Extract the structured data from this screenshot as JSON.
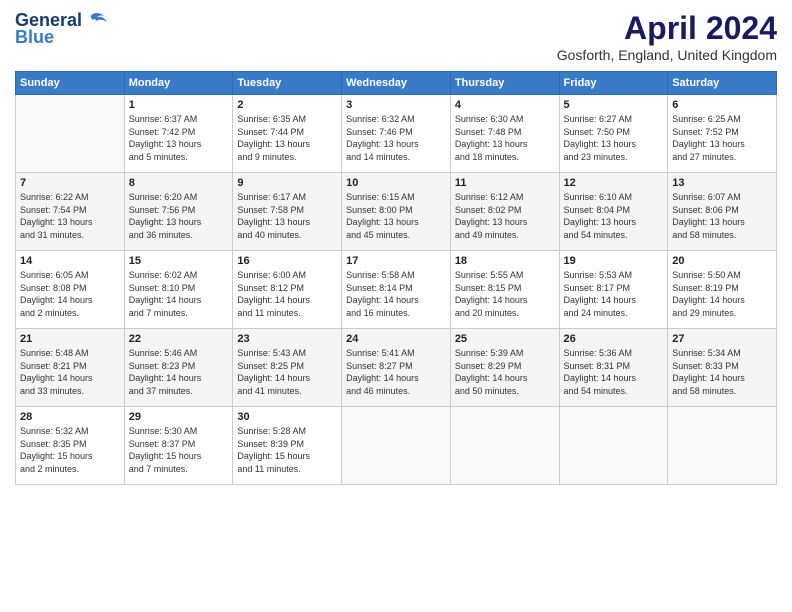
{
  "header": {
    "logo_line1": "General",
    "logo_line2": "Blue",
    "month": "April 2024",
    "location": "Gosforth, England, United Kingdom"
  },
  "weekdays": [
    "Sunday",
    "Monday",
    "Tuesday",
    "Wednesday",
    "Thursday",
    "Friday",
    "Saturday"
  ],
  "weeks": [
    [
      {
        "day": "",
        "info": ""
      },
      {
        "day": "1",
        "info": "Sunrise: 6:37 AM\nSunset: 7:42 PM\nDaylight: 13 hours\nand 5 minutes."
      },
      {
        "day": "2",
        "info": "Sunrise: 6:35 AM\nSunset: 7:44 PM\nDaylight: 13 hours\nand 9 minutes."
      },
      {
        "day": "3",
        "info": "Sunrise: 6:32 AM\nSunset: 7:46 PM\nDaylight: 13 hours\nand 14 minutes."
      },
      {
        "day": "4",
        "info": "Sunrise: 6:30 AM\nSunset: 7:48 PM\nDaylight: 13 hours\nand 18 minutes."
      },
      {
        "day": "5",
        "info": "Sunrise: 6:27 AM\nSunset: 7:50 PM\nDaylight: 13 hours\nand 23 minutes."
      },
      {
        "day": "6",
        "info": "Sunrise: 6:25 AM\nSunset: 7:52 PM\nDaylight: 13 hours\nand 27 minutes."
      }
    ],
    [
      {
        "day": "7",
        "info": "Sunrise: 6:22 AM\nSunset: 7:54 PM\nDaylight: 13 hours\nand 31 minutes."
      },
      {
        "day": "8",
        "info": "Sunrise: 6:20 AM\nSunset: 7:56 PM\nDaylight: 13 hours\nand 36 minutes."
      },
      {
        "day": "9",
        "info": "Sunrise: 6:17 AM\nSunset: 7:58 PM\nDaylight: 13 hours\nand 40 minutes."
      },
      {
        "day": "10",
        "info": "Sunrise: 6:15 AM\nSunset: 8:00 PM\nDaylight: 13 hours\nand 45 minutes."
      },
      {
        "day": "11",
        "info": "Sunrise: 6:12 AM\nSunset: 8:02 PM\nDaylight: 13 hours\nand 49 minutes."
      },
      {
        "day": "12",
        "info": "Sunrise: 6:10 AM\nSunset: 8:04 PM\nDaylight: 13 hours\nand 54 minutes."
      },
      {
        "day": "13",
        "info": "Sunrise: 6:07 AM\nSunset: 8:06 PM\nDaylight: 13 hours\nand 58 minutes."
      }
    ],
    [
      {
        "day": "14",
        "info": "Sunrise: 6:05 AM\nSunset: 8:08 PM\nDaylight: 14 hours\nand 2 minutes."
      },
      {
        "day": "15",
        "info": "Sunrise: 6:02 AM\nSunset: 8:10 PM\nDaylight: 14 hours\nand 7 minutes."
      },
      {
        "day": "16",
        "info": "Sunrise: 6:00 AM\nSunset: 8:12 PM\nDaylight: 14 hours\nand 11 minutes."
      },
      {
        "day": "17",
        "info": "Sunrise: 5:58 AM\nSunset: 8:14 PM\nDaylight: 14 hours\nand 16 minutes."
      },
      {
        "day": "18",
        "info": "Sunrise: 5:55 AM\nSunset: 8:15 PM\nDaylight: 14 hours\nand 20 minutes."
      },
      {
        "day": "19",
        "info": "Sunrise: 5:53 AM\nSunset: 8:17 PM\nDaylight: 14 hours\nand 24 minutes."
      },
      {
        "day": "20",
        "info": "Sunrise: 5:50 AM\nSunset: 8:19 PM\nDaylight: 14 hours\nand 29 minutes."
      }
    ],
    [
      {
        "day": "21",
        "info": "Sunrise: 5:48 AM\nSunset: 8:21 PM\nDaylight: 14 hours\nand 33 minutes."
      },
      {
        "day": "22",
        "info": "Sunrise: 5:46 AM\nSunset: 8:23 PM\nDaylight: 14 hours\nand 37 minutes."
      },
      {
        "day": "23",
        "info": "Sunrise: 5:43 AM\nSunset: 8:25 PM\nDaylight: 14 hours\nand 41 minutes."
      },
      {
        "day": "24",
        "info": "Sunrise: 5:41 AM\nSunset: 8:27 PM\nDaylight: 14 hours\nand 46 minutes."
      },
      {
        "day": "25",
        "info": "Sunrise: 5:39 AM\nSunset: 8:29 PM\nDaylight: 14 hours\nand 50 minutes."
      },
      {
        "day": "26",
        "info": "Sunrise: 5:36 AM\nSunset: 8:31 PM\nDaylight: 14 hours\nand 54 minutes."
      },
      {
        "day": "27",
        "info": "Sunrise: 5:34 AM\nSunset: 8:33 PM\nDaylight: 14 hours\nand 58 minutes."
      }
    ],
    [
      {
        "day": "28",
        "info": "Sunrise: 5:32 AM\nSunset: 8:35 PM\nDaylight: 15 hours\nand 2 minutes."
      },
      {
        "day": "29",
        "info": "Sunrise: 5:30 AM\nSunset: 8:37 PM\nDaylight: 15 hours\nand 7 minutes."
      },
      {
        "day": "30",
        "info": "Sunrise: 5:28 AM\nSunset: 8:39 PM\nDaylight: 15 hours\nand 11 minutes."
      },
      {
        "day": "",
        "info": ""
      },
      {
        "day": "",
        "info": ""
      },
      {
        "day": "",
        "info": ""
      },
      {
        "day": "",
        "info": ""
      }
    ]
  ]
}
